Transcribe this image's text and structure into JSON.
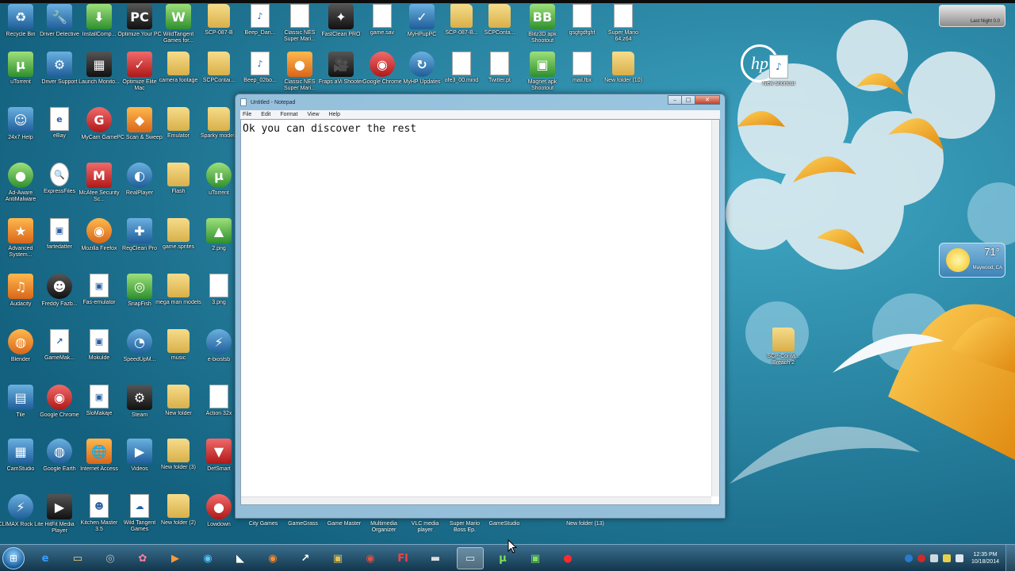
{
  "notepad": {
    "title": "Untitled - Notepad",
    "menu": [
      "File",
      "Edit",
      "Format",
      "View",
      "Help"
    ],
    "content": "Ok you can discover the rest",
    "buttons": {
      "minimize": "–",
      "maximize": "□",
      "close": "✕"
    }
  },
  "desktop_icons": [
    {
      "label": "Recycle Bin",
      "kind": "app",
      "glyph": "♻",
      "icon": "recycle-bin-icon",
      "col": 0,
      "row": 0
    },
    {
      "label": "Driver Detective",
      "kind": "app",
      "glyph": "🔧",
      "icon": "driver-icon",
      "col": 1,
      "row": 0
    },
    {
      "label": "InstallComp...",
      "kind": "green",
      "glyph": "⬇",
      "icon": "install-icon",
      "col": 2,
      "row": 0
    },
    {
      "label": "Optimize Your PC",
      "kind": "dark",
      "glyph": "PC",
      "icon": "optimize-pc-icon",
      "col": 3,
      "row": 0
    },
    {
      "label": "WildTangent Games for...",
      "kind": "green",
      "glyph": "W",
      "icon": "wildtangent-icon",
      "col": 4,
      "row": 0
    },
    {
      "label": "SCP-087-B",
      "kind": "folder",
      "glyph": "",
      "icon": "folder-icon",
      "col": 5,
      "row": 0
    },
    {
      "label": "Beep_Dan...",
      "kind": "doc",
      "glyph": "♪",
      "icon": "audio-file-icon",
      "col": 6,
      "row": 0
    },
    {
      "label": "Classic NES Super Mari...",
      "kind": "doc",
      "glyph": "",
      "icon": "file-icon",
      "col": 7,
      "row": 0
    },
    {
      "label": "FastClean PRO",
      "kind": "dark",
      "glyph": "✦",
      "icon": "fastclean-icon",
      "col": 8,
      "row": 0
    },
    {
      "label": "game.sav",
      "kind": "doc",
      "glyph": "",
      "icon": "file-icon",
      "col": 9,
      "row": 0
    },
    {
      "label": "MyHPupPC",
      "kind": "app",
      "glyph": "✓",
      "icon": "hp-support-icon",
      "col": 10,
      "row": 0
    },
    {
      "label": "SCP-087-B...",
      "kind": "folder",
      "glyph": "",
      "icon": "folder-icon",
      "col": 11,
      "row": 0
    },
    {
      "label": "SCPConta...",
      "kind": "folder",
      "glyph": "",
      "icon": "folder-icon",
      "col": 12,
      "row": 0
    },
    {
      "label": "Blitz3D apk Shootout",
      "kind": "green",
      "glyph": "BB",
      "icon": "blitz-icon",
      "col": 13,
      "row": 0
    },
    {
      "label": "gsgfgdfghf",
      "kind": "doc",
      "glyph": "",
      "icon": "file-icon",
      "col": 14,
      "row": 0
    },
    {
      "label": "Super Mario 64.z64",
      "kind": "doc",
      "glyph": "",
      "icon": "file-icon",
      "col": 15,
      "row": 0
    },
    {
      "label": "uTorrent",
      "kind": "green",
      "glyph": "µ",
      "icon": "utorrent-icon",
      "col": 0,
      "row": 1
    },
    {
      "label": "Driver Support",
      "kind": "app",
      "glyph": "⚙",
      "icon": "gear-icon",
      "col": 1,
      "row": 1
    },
    {
      "label": "Launch Monito...",
      "kind": "dark",
      "glyph": "▦",
      "icon": "monitor-icon",
      "col": 2,
      "row": 1
    },
    {
      "label": "Optimize Elite Mac",
      "kind": "red",
      "glyph": "✓",
      "icon": "shield-icon",
      "col": 3,
      "row": 1
    },
    {
      "label": "camera footage",
      "kind": "folder",
      "glyph": "",
      "icon": "folder-icon",
      "col": 4,
      "row": 1
    },
    {
      "label": "SCPContai...",
      "kind": "folder",
      "glyph": "",
      "icon": "folder-icon",
      "col": 5,
      "row": 1
    },
    {
      "label": "Beep_02bo...",
      "kind": "doc",
      "glyph": "♪",
      "icon": "audio-file-icon",
      "col": 6,
      "row": 1
    },
    {
      "label": "Classic NES Super Mari...",
      "kind": "orange",
      "glyph": "●",
      "icon": "rom-icon",
      "col": 7,
      "row": 1
    },
    {
      "label": "Fraps aVi Shooter",
      "kind": "dark",
      "glyph": "🎥",
      "icon": "camera-icon",
      "col": 8,
      "row": 1
    },
    {
      "label": "Google Chrome",
      "kind": "red",
      "glyph": "◉",
      "icon": "chrome-icon",
      "col": 9,
      "row": 1,
      "round": true
    },
    {
      "label": "MyHP Updates",
      "kind": "app",
      "glyph": "↻",
      "icon": "update-icon",
      "col": 10,
      "row": 1,
      "round": true
    },
    {
      "label": "ofe3_00.mind",
      "kind": "doc",
      "glyph": "",
      "icon": "file-icon",
      "col": 11,
      "row": 1
    },
    {
      "label": "Twitter.pt",
      "kind": "doc",
      "glyph": "",
      "icon": "file-icon",
      "col": 12,
      "row": 1
    },
    {
      "label": "Magnet apk Shootout",
      "kind": "green",
      "glyph": "▣",
      "icon": "shortcut-icon",
      "col": 13,
      "row": 1
    },
    {
      "label": "mail.fbx",
      "kind": "doc",
      "glyph": "",
      "icon": "file-icon",
      "col": 14,
      "row": 1
    },
    {
      "label": "New folder (10)",
      "kind": "folder",
      "glyph": "",
      "icon": "folder-icon",
      "col": 15,
      "row": 1
    },
    {
      "label": "24x7 Help",
      "kind": "app",
      "glyph": "☺",
      "icon": "help-person-icon",
      "col": 0,
      "row": 2
    },
    {
      "label": "eBay",
      "kind": "doc",
      "glyph": "e",
      "icon": "ebay-icon",
      "col": 1,
      "row": 2
    },
    {
      "label": "MyCam Game",
      "kind": "red",
      "glyph": "G",
      "icon": "game-icon",
      "col": 2,
      "row": 2,
      "round": true
    },
    {
      "label": "PC Scan & Sweep",
      "kind": "orange",
      "glyph": "◆",
      "icon": "scan-icon",
      "col": 3,
      "row": 2
    },
    {
      "label": "Emulator",
      "kind": "folder",
      "glyph": "",
      "icon": "folder-icon",
      "col": 4,
      "row": 2
    },
    {
      "label": "Sparky models",
      "kind": "folder",
      "glyph": "",
      "icon": "folder-icon",
      "col": 5,
      "row": 2
    },
    {
      "label": "Ad-Aware AntiMalware",
      "kind": "green",
      "glyph": "●",
      "icon": "antimalware-icon",
      "col": 0,
      "row": 3,
      "round": true
    },
    {
      "label": "ExpressFiles",
      "kind": "doc",
      "glyph": "🔍",
      "icon": "search-icon",
      "col": 1,
      "row": 3,
      "round": true
    },
    {
      "label": "McAfee Security Sc...",
      "kind": "red",
      "glyph": "M",
      "icon": "mcafee-icon",
      "col": 2,
      "row": 3
    },
    {
      "label": "RealPlayer",
      "kind": "app",
      "glyph": "◐",
      "icon": "realplayer-icon",
      "col": 3,
      "row": 3,
      "round": true
    },
    {
      "label": "Flash",
      "kind": "folder",
      "glyph": "",
      "icon": "folder-icon",
      "col": 4,
      "row": 3
    },
    {
      "label": "uTorrent",
      "kind": "green",
      "glyph": "µ",
      "icon": "utorrent-icon",
      "col": 5,
      "row": 3,
      "round": true
    },
    {
      "label": "Advanced System...",
      "kind": "orange",
      "glyph": "★",
      "icon": "system-icon",
      "col": 0,
      "row": 4
    },
    {
      "label": "fartedatter",
      "kind": "doc",
      "glyph": "▣",
      "icon": "shortcut-icon",
      "col": 1,
      "row": 4
    },
    {
      "label": "Mozilla Firefox",
      "kind": "orange",
      "glyph": "◉",
      "icon": "firefox-icon",
      "col": 2,
      "row": 4,
      "round": true
    },
    {
      "label": "RegClean Pro",
      "kind": "app",
      "glyph": "✚",
      "icon": "regclean-icon",
      "col": 3,
      "row": 4
    },
    {
      "label": "game.sprites",
      "kind": "folder",
      "glyph": "",
      "icon": "folder-icon",
      "col": 4,
      "row": 4
    },
    {
      "label": "2.png",
      "kind": "green",
      "glyph": "▲",
      "icon": "image-icon",
      "col": 5,
      "row": 4
    },
    {
      "label": "Audacity",
      "kind": "orange",
      "glyph": "♫",
      "icon": "audacity-icon",
      "col": 0,
      "row": 5
    },
    {
      "label": "Freddy Fazb...",
      "kind": "dark",
      "glyph": "☻",
      "icon": "game-icon",
      "col": 1,
      "row": 5,
      "round": true
    },
    {
      "label": "Fas-emulator",
      "kind": "doc",
      "glyph": "▣",
      "icon": "shortcut-icon",
      "col": 2,
      "row": 5
    },
    {
      "label": "SnapFish",
      "kind": "green",
      "glyph": "◎",
      "icon": "snapfish-icon",
      "col": 3,
      "row": 5
    },
    {
      "label": "mega man models",
      "kind": "folder",
      "glyph": "",
      "icon": "folder-icon",
      "col": 4,
      "row": 5
    },
    {
      "label": "3.png",
      "kind": "doc",
      "glyph": "",
      "icon": "image-icon",
      "col": 5,
      "row": 5
    },
    {
      "label": "Blender",
      "kind": "orange",
      "glyph": "◍",
      "icon": "blender-icon",
      "col": 0,
      "row": 6,
      "round": true
    },
    {
      "label": "GameMak...",
      "kind": "doc",
      "glyph": "↗",
      "icon": "gamemaker-icon",
      "col": 1,
      "row": 6
    },
    {
      "label": "Mokulde",
      "kind": "doc",
      "glyph": "▣",
      "icon": "shortcut-icon",
      "col": 2,
      "row": 6
    },
    {
      "label": "SpeedUpM...",
      "kind": "app",
      "glyph": "◔",
      "icon": "speedometer-icon",
      "col": 3,
      "row": 6,
      "round": true
    },
    {
      "label": "music",
      "kind": "folder",
      "glyph": "",
      "icon": "folder-icon",
      "col": 4,
      "row": 6
    },
    {
      "label": "e-biostsb",
      "kind": "app",
      "glyph": "⚡",
      "icon": "lightning-icon",
      "col": 5,
      "row": 6,
      "round": true
    },
    {
      "label": "Tile",
      "kind": "app",
      "glyph": "▤",
      "icon": "tile-icon",
      "col": 0,
      "row": 7
    },
    {
      "label": "Google Chrome",
      "kind": "red",
      "glyph": "◉",
      "icon": "chrome-icon",
      "col": 1,
      "row": 7,
      "round": true
    },
    {
      "label": "SloMakaje",
      "kind": "doc",
      "glyph": "▣",
      "icon": "shortcut-icon",
      "col": 2,
      "row": 7
    },
    {
      "label": "Steam",
      "kind": "dark",
      "glyph": "⚙",
      "icon": "steam-icon",
      "col": 3,
      "row": 7
    },
    {
      "label": "New folder",
      "kind": "folder",
      "glyph": "",
      "icon": "folder-icon",
      "col": 4,
      "row": 7
    },
    {
      "label": "Action 32x",
      "kind": "doc",
      "glyph": "",
      "icon": "file-icon",
      "col": 5,
      "row": 7
    },
    {
      "label": "CamStudio",
      "kind": "app",
      "glyph": "▦",
      "icon": "camstudio-icon",
      "col": 0,
      "row": 8
    },
    {
      "label": "Google Earth",
      "kind": "app",
      "glyph": "◍",
      "icon": "globe-icon",
      "col": 1,
      "row": 8,
      "round": true
    },
    {
      "label": "Internet Access",
      "kind": "orange",
      "glyph": "🌐",
      "icon": "globe-icon",
      "col": 2,
      "row": 8
    },
    {
      "label": "Videos",
      "kind": "app",
      "glyph": "▶",
      "icon": "video-icon",
      "col": 3,
      "row": 8
    },
    {
      "label": "New folder (3)",
      "kind": "folder",
      "glyph": "",
      "icon": "folder-icon",
      "col": 4,
      "row": 8
    },
    {
      "label": "DefSmart",
      "kind": "red",
      "glyph": "▼",
      "icon": "shield-icon",
      "col": 5,
      "row": 8
    },
    {
      "label": "CLIMAX Rock Lite",
      "kind": "app",
      "glyph": "⚡",
      "icon": "lightning-icon",
      "col": 0,
      "row": 9,
      "round": true
    },
    {
      "label": "HitFit Media Player",
      "kind": "dark",
      "glyph": "▶",
      "icon": "media-player-icon",
      "col": 1,
      "row": 9
    },
    {
      "label": "Kitchen Master 3.5",
      "kind": "doc",
      "glyph": "☻",
      "icon": "game-icon",
      "col": 2,
      "row": 9
    },
    {
      "label": "Wild Tangent Games",
      "kind": "doc",
      "glyph": "☁",
      "icon": "cloud-icon",
      "col": 3,
      "row": 9
    },
    {
      "label": "New folder (2)",
      "kind": "folder",
      "glyph": "",
      "icon": "folder-icon",
      "col": 4,
      "row": 9
    },
    {
      "label": "Lowdown",
      "kind": "red",
      "glyph": "●",
      "icon": "game-icon",
      "col": 5,
      "row": 9,
      "round": true
    }
  ],
  "bottom_labels": [
    "City Games",
    "GameGrass",
    "Game Master",
    "Multimedia Organizer",
    "VLC media player",
    "Super Mario Boss Ep.",
    "GameStudio",
    "New folder (13)"
  ],
  "right_icons": [
    {
      "label": "New shortcut",
      "kind": "doc",
      "glyph": "♪",
      "icon": "audio-file-icon"
    },
    {
      "label": "SCP-Conta... Breach 2",
      "kind": "folder",
      "glyph": "",
      "icon": "folder-icon"
    }
  ],
  "branding": {
    "logo": "hp"
  },
  "weather": {
    "temperature": "71°",
    "city": "Maywood, CA"
  },
  "top_gadget": {
    "text": "Last Night 0.0"
  },
  "taskbar": {
    "start_glyph": "⊞",
    "items": [
      {
        "glyph": "e",
        "icon": "internet-explorer-icon",
        "color": "#3aa0ff"
      },
      {
        "glyph": "▭",
        "icon": "file-explorer-icon",
        "color": "#f2d27a"
      },
      {
        "glyph": "◎",
        "icon": "media-icon",
        "color": "#bbbbbb"
      },
      {
        "glyph": "✿",
        "icon": "paint-icon",
        "color": "#ff7fa0"
      },
      {
        "glyph": "▶",
        "icon": "media-player-icon",
        "color": "#ff9a3a"
      },
      {
        "glyph": "◉",
        "icon": "hp-icon",
        "color": "#58c8ff"
      },
      {
        "glyph": "◣",
        "icon": "app-icon",
        "color": "#ffffff"
      },
      {
        "glyph": "◉",
        "icon": "firefox-icon",
        "color": "#ff8a2a"
      },
      {
        "glyph": "↗",
        "icon": "gamemaker-icon",
        "color": "#ffffff"
      },
      {
        "glyph": "▣",
        "icon": "app-icon",
        "color": "#e0c050"
      },
      {
        "glyph": "◉",
        "icon": "chrome-icon",
        "color": "#e84c3d"
      },
      {
        "glyph": "Fl",
        "icon": "flash-icon",
        "color": "#ff4040"
      },
      {
        "glyph": "▬",
        "icon": "keyboard-icon",
        "color": "#dddddd"
      },
      {
        "glyph": "▭",
        "icon": "notepad-icon",
        "color": "#dde9f5",
        "active": true
      },
      {
        "glyph": "µ",
        "icon": "utorrent-icon",
        "color": "#7ee05a"
      },
      {
        "glyph": "▣",
        "icon": "shortcut-icon",
        "color": "#7ee05a"
      },
      {
        "glyph": "●",
        "icon": "recorder-icon",
        "color": "#ff2a2a"
      }
    ],
    "clock": {
      "time": "12:35 PM",
      "date": "10/18/2014"
    }
  }
}
